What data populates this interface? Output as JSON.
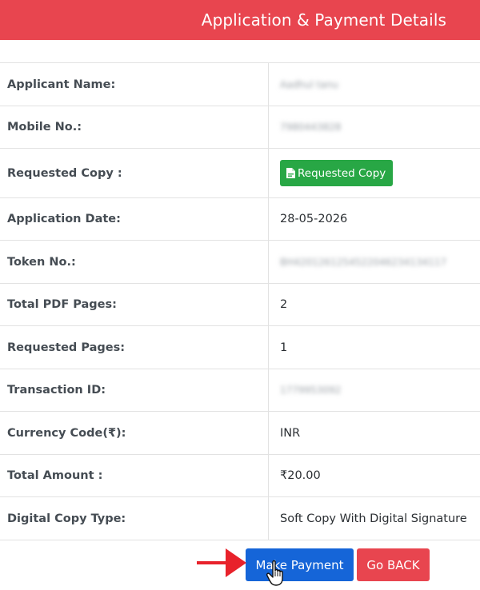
{
  "header": {
    "title": "Application & Payment Details"
  },
  "details": [
    {
      "label": "Applicant Name:",
      "value": "Aadhul tanu",
      "blurred": true,
      "kind": "text"
    },
    {
      "label": "Mobile No.:",
      "value": "7980443828",
      "blurred": true,
      "kind": "text"
    },
    {
      "label": "Requested Copy :",
      "value": "Requested Copy",
      "blurred": false,
      "kind": "button",
      "icon": "pdf-file-icon"
    },
    {
      "label": "Application Date:",
      "value": "28-05-2026",
      "blurred": false,
      "kind": "text"
    },
    {
      "label": "Token No.:",
      "value": "BH4201261254522046234134117",
      "blurred": true,
      "kind": "text"
    },
    {
      "label": "Total PDF Pages:",
      "value": "2",
      "blurred": false,
      "kind": "text"
    },
    {
      "label": "Requested Pages:",
      "value": "1",
      "blurred": false,
      "kind": "text"
    },
    {
      "label": "Transaction ID:",
      "value": "1779953092",
      "blurred": true,
      "kind": "text"
    },
    {
      "label": "Currency Code(₹):",
      "value": "INR",
      "blurred": false,
      "kind": "text"
    },
    {
      "label": "Total Amount :",
      "value": "₹20.00",
      "blurred": false,
      "kind": "text"
    },
    {
      "label": "Digital Copy Type:",
      "value": "Soft Copy With Digital Signature",
      "blurred": false,
      "kind": "text"
    }
  ],
  "actions": {
    "pay_label": "Make Payment",
    "back_label": "Go BACK"
  },
  "colors": {
    "header_bg": "#e8454f",
    "requested_copy_bg": "#28a745",
    "pay_bg": "#1565d8",
    "back_bg": "#e8454f",
    "annotation_arrow": "#e8222b"
  },
  "icons": [
    "pdf-file-icon",
    "red-arrow-icon",
    "hand-cursor-icon"
  ]
}
